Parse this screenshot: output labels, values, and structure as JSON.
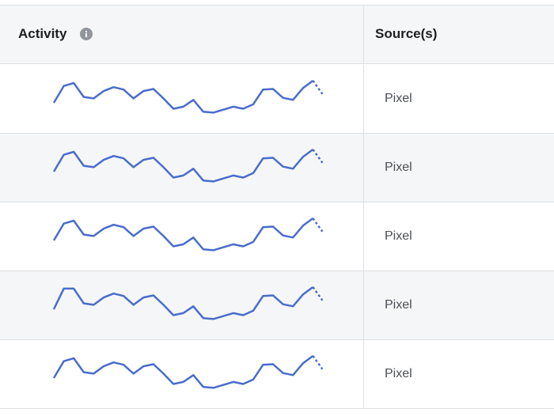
{
  "table": {
    "columns": {
      "activity": "Activity",
      "activity_info_icon": "info-icon",
      "source": "Source(s)"
    },
    "rows": [
      {
        "source": "Pixel",
        "activity": [
          0.25,
          0.82,
          0.92,
          0.45,
          0.4,
          0.65,
          0.78,
          0.7,
          0.4,
          0.65,
          0.72,
          0.4,
          0.05,
          0.12,
          0.35,
          -0.05,
          -0.08,
          0.02,
          0.12,
          0.05,
          0.2,
          0.7,
          0.72,
          0.42,
          0.35,
          0.75,
          1.0
        ],
        "activity_tail": [
          1.0,
          0.55
        ]
      },
      {
        "source": "Pixel",
        "activity": [
          0.25,
          0.82,
          0.92,
          0.45,
          0.4,
          0.65,
          0.78,
          0.7,
          0.4,
          0.65,
          0.72,
          0.4,
          0.05,
          0.12,
          0.35,
          -0.05,
          -0.08,
          0.02,
          0.12,
          0.05,
          0.2,
          0.7,
          0.72,
          0.42,
          0.35,
          0.75,
          1.0
        ],
        "activity_tail": [
          1.0,
          0.55
        ]
      },
      {
        "source": "Pixel",
        "activity": [
          0.25,
          0.82,
          0.92,
          0.45,
          0.4,
          0.65,
          0.78,
          0.7,
          0.4,
          0.65,
          0.72,
          0.4,
          0.05,
          0.12,
          0.35,
          -0.05,
          -0.08,
          0.02,
          0.12,
          0.05,
          0.2,
          0.7,
          0.72,
          0.42,
          0.35,
          0.75,
          1.0
        ],
        "activity_tail": [
          1.0,
          0.55
        ]
      },
      {
        "source": "Pixel",
        "activity": [
          0.25,
          0.95,
          0.95,
          0.45,
          0.4,
          0.65,
          0.78,
          0.7,
          0.4,
          0.65,
          0.72,
          0.4,
          0.05,
          0.12,
          0.35,
          -0.05,
          -0.08,
          0.02,
          0.12,
          0.05,
          0.2,
          0.7,
          0.72,
          0.42,
          0.35,
          0.75,
          1.0
        ],
        "activity_tail": [
          1.0,
          0.55
        ]
      },
      {
        "source": "Pixel",
        "activity": [
          0.25,
          0.82,
          0.92,
          0.45,
          0.4,
          0.65,
          0.78,
          0.7,
          0.4,
          0.65,
          0.72,
          0.4,
          0.05,
          0.12,
          0.35,
          -0.05,
          -0.08,
          0.02,
          0.12,
          0.05,
          0.2,
          0.7,
          0.72,
          0.42,
          0.35,
          0.75,
          1.0
        ],
        "activity_tail": [
          1.0,
          0.55
        ]
      }
    ]
  },
  "colors": {
    "sparkline": "#4a6ccc",
    "header_bg": "#f5f6f7",
    "border": "#dddfe2",
    "info_icon": "#90949c"
  }
}
